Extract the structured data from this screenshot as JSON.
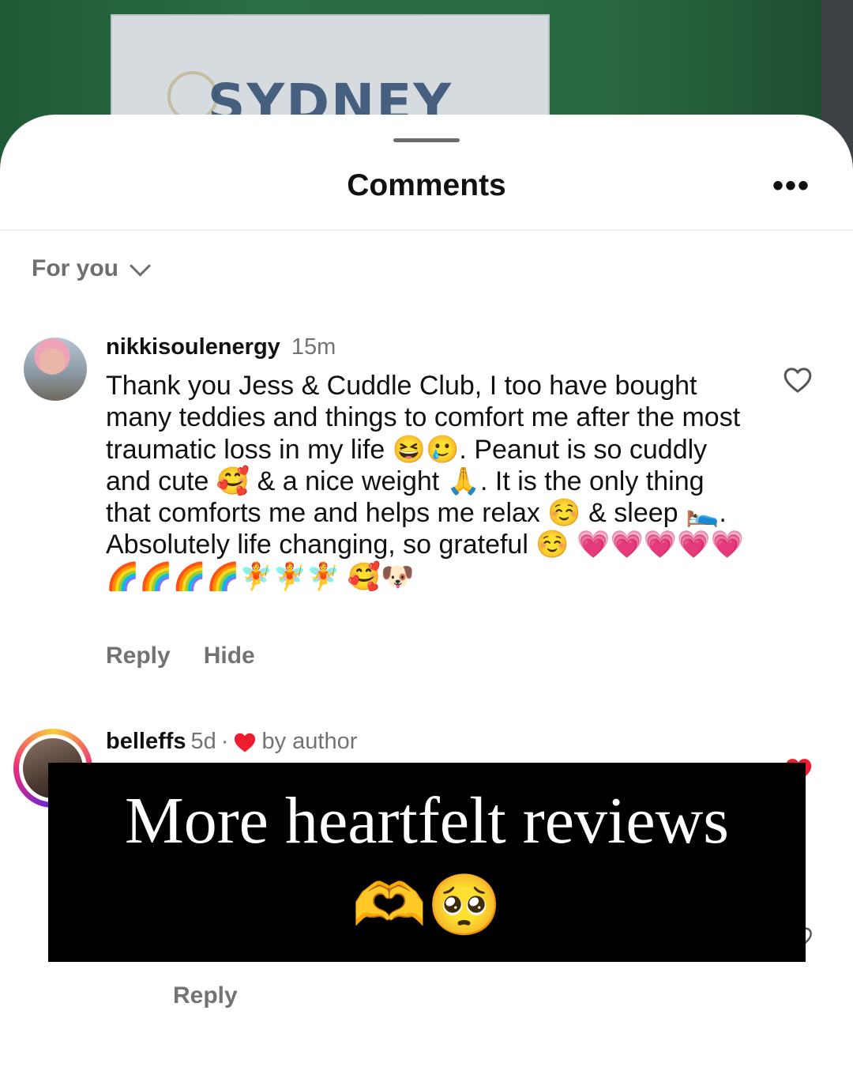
{
  "background": {
    "sign_text": "SYDNEY"
  },
  "header": {
    "title": "Comments",
    "more_label": "•••"
  },
  "filter": {
    "label": "For you"
  },
  "comments": [
    {
      "username": "nikkisoulenergy",
      "time": "15m",
      "text": "Thank you Jess & Cuddle Club, I too have bought many teddies and things to comfort me after the most traumatic loss in my life 😆🥲. Peanut is so cuddly and cute 🥰 & a nice weight 🙏. It is the only thing that comforts me and helps me relax ☺️ & sleep 🛌. Absolutely life changing, so grateful ☺️ 💗💗💗💗💗🌈🌈🌈🌈🧚🧚🧚 🥰🐶",
      "actions": [
        "Reply",
        "Hide"
      ]
    },
    {
      "username": "belleffs",
      "time": "5d",
      "meta_separator": "·",
      "liked_by_author_label": "by author",
      "actions": [
        "Reply"
      ]
    }
  ],
  "overlay": {
    "title": "More heartfelt reviews",
    "emoji": "🫶🥺"
  },
  "colors": {
    "heart_red": "#ed1c2e",
    "muted": "#737373"
  }
}
